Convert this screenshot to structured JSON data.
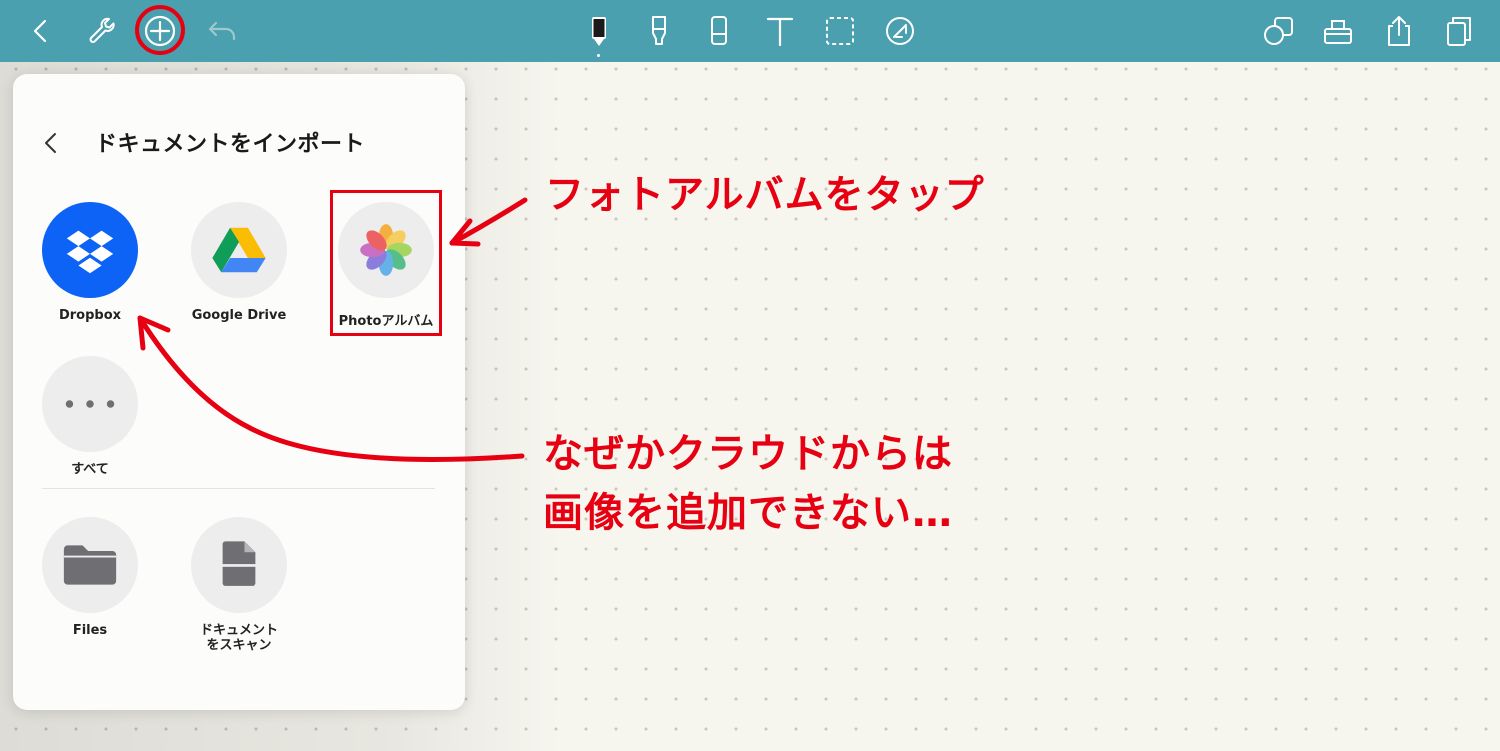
{
  "toolbar": {
    "color": "#4aa0ae",
    "left_icons": [
      "back-chevron-icon",
      "wrench-icon",
      "add-plus-icon",
      "undo-icon"
    ],
    "center_tools": [
      "pen-tool-icon",
      "highlighter-tool-icon",
      "eraser-tool-icon",
      "text-tool-icon",
      "lasso-select-icon",
      "shape-tool-icon"
    ],
    "right_icons": [
      "shapes-panel-icon",
      "zoom-window-icon",
      "share-icon",
      "page-copy-icon"
    ]
  },
  "import_panel": {
    "title": "ドキュメントをインポート",
    "sources": [
      {
        "label": "Dropbox",
        "icon": "dropbox-icon"
      },
      {
        "label": "Google Drive",
        "icon": "google-drive-icon"
      },
      {
        "label": "Photoアルバム",
        "icon": "photos-icon"
      },
      {
        "label": "すべて",
        "icon": "more-dots-icon"
      }
    ],
    "actions": [
      {
        "label": "Files",
        "icon": "folder-icon"
      },
      {
        "label": "ドキュメント\nをスキャン",
        "icon": "scan-document-icon"
      }
    ]
  },
  "annotations": {
    "accent_color": "#e60012",
    "photo_tap": "フォトアルバムをタップ",
    "cloud_line1": "なぜかクラウドからは",
    "cloud_line2": "画像を追加できない…"
  }
}
